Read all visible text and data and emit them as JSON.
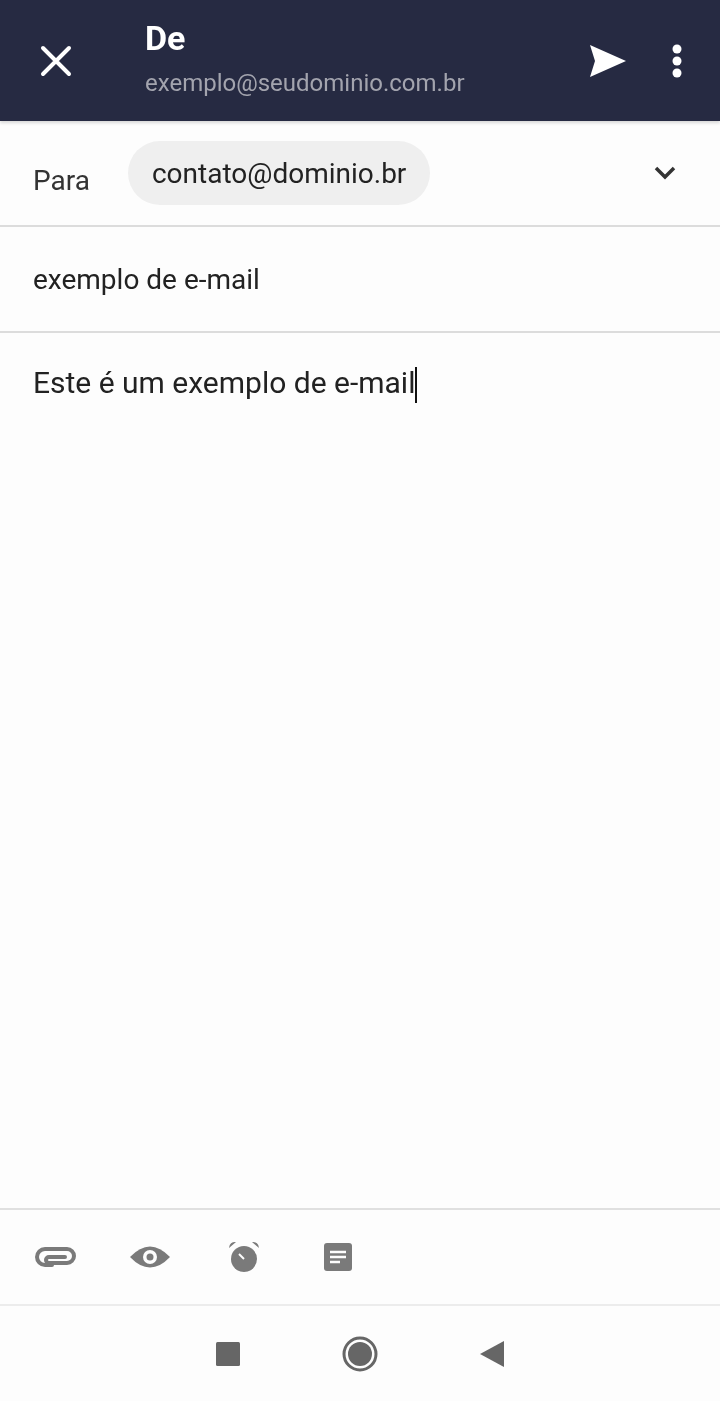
{
  "header": {
    "title": "De",
    "from": "exemplo@seudominio.com.br"
  },
  "to": {
    "label": "Para",
    "recipients": [
      "contato@dominio.br"
    ]
  },
  "subject": {
    "value": "exemplo de e-mail"
  },
  "body": {
    "value": "Este é um exemplo de e-mail"
  }
}
